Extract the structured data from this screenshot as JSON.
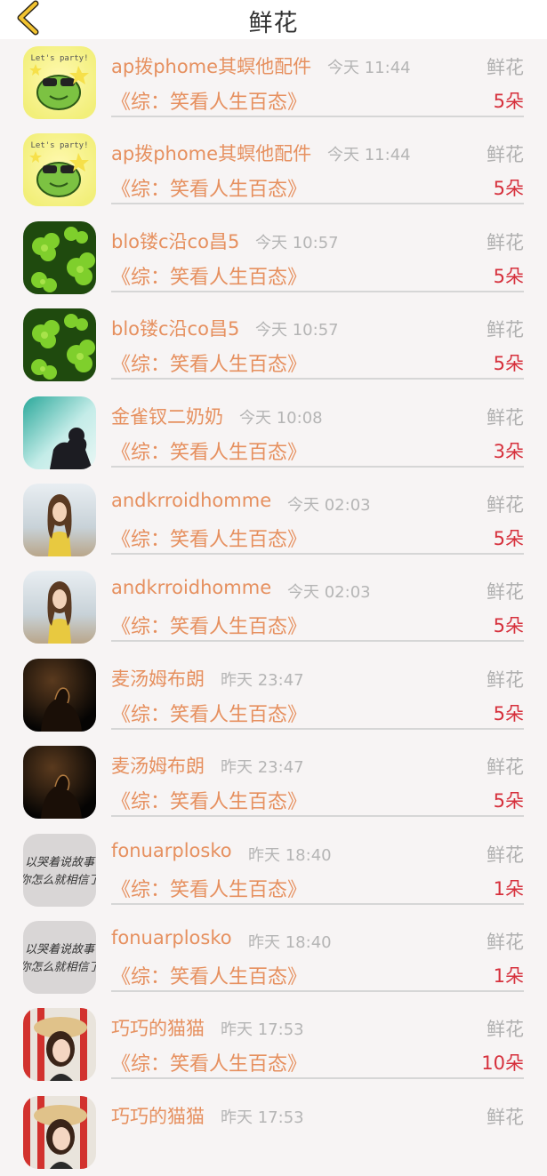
{
  "header": {
    "title": "鲜花",
    "back_icon": "chevron-left-icon",
    "accent": "#f2c330"
  },
  "colors": {
    "name": "#e6905f",
    "time": "#b5b5b5",
    "count": "#d6303c"
  },
  "items": [
    {
      "avatar": "party-frog-avatar",
      "name": "ap拨phome其螟他配件",
      "time": "今天 11:44",
      "gift": "鲜花",
      "book": "《综：笑看人生百态》",
      "count": "5朵"
    },
    {
      "avatar": "party-frog-avatar",
      "name": "ap拨phome其螟他配件",
      "time": "今天 11:44",
      "gift": "鲜花",
      "book": "《综：笑看人生百态》",
      "count": "5朵"
    },
    {
      "avatar": "clover-avatar",
      "name": "blo镂c沿co昌5",
      "time": "今天 10:57",
      "gift": "鲜花",
      "book": "《综：笑看人生百态》",
      "count": "5朵"
    },
    {
      "avatar": "clover-avatar",
      "name": "blo镂c沿co昌5",
      "time": "今天 10:57",
      "gift": "鲜花",
      "book": "《综：笑看人生百态》",
      "count": "5朵"
    },
    {
      "avatar": "silhouette-avatar",
      "name": "金雀钗二奶奶",
      "time": "今天 10:08",
      "gift": "鲜花",
      "book": "《综：笑看人生百态》",
      "count": "3朵"
    },
    {
      "avatar": "girl-beach-avatar",
      "name": "andkrroidhomme",
      "time": "今天 02:03",
      "gift": "鲜花",
      "book": "《综：笑看人生百态》",
      "count": "5朵"
    },
    {
      "avatar": "girl-beach-avatar",
      "name": "andkrroidhomme",
      "time": "今天 02:03",
      "gift": "鲜花",
      "book": "《综：笑看人生百态》",
      "count": "5朵"
    },
    {
      "avatar": "dark-figure-avatar",
      "name": "麦汤姆布朗",
      "time": "昨天 23:47",
      "gift": "鲜花",
      "book": "《综：笑看人生百态》",
      "count": "5朵"
    },
    {
      "avatar": "dark-figure-avatar",
      "name": "麦汤姆布朗",
      "time": "昨天 23:47",
      "gift": "鲜花",
      "book": "《综：笑看人生百态》",
      "count": "5朵"
    },
    {
      "avatar": "handwriting-avatar",
      "name": "fonuarplosko",
      "time": "昨天 18:40",
      "gift": "鲜花",
      "book": "《综：笑看人生百态》",
      "count": "1朵"
    },
    {
      "avatar": "handwriting-avatar",
      "name": "fonuarplosko",
      "time": "昨天 18:40",
      "gift": "鲜花",
      "book": "《综：笑看人生百态》",
      "count": "1朵"
    },
    {
      "avatar": "hat-girl-avatar",
      "name": "巧巧的猫猫",
      "time": "昨天 17:53",
      "gift": "鲜花",
      "book": "《综：笑看人生百态》",
      "count": "10朵"
    },
    {
      "avatar": "hat-girl-avatar",
      "name": "巧巧的猫猫",
      "time": "昨天 17:53",
      "gift": "鲜花",
      "book": "",
      "count": ""
    }
  ]
}
